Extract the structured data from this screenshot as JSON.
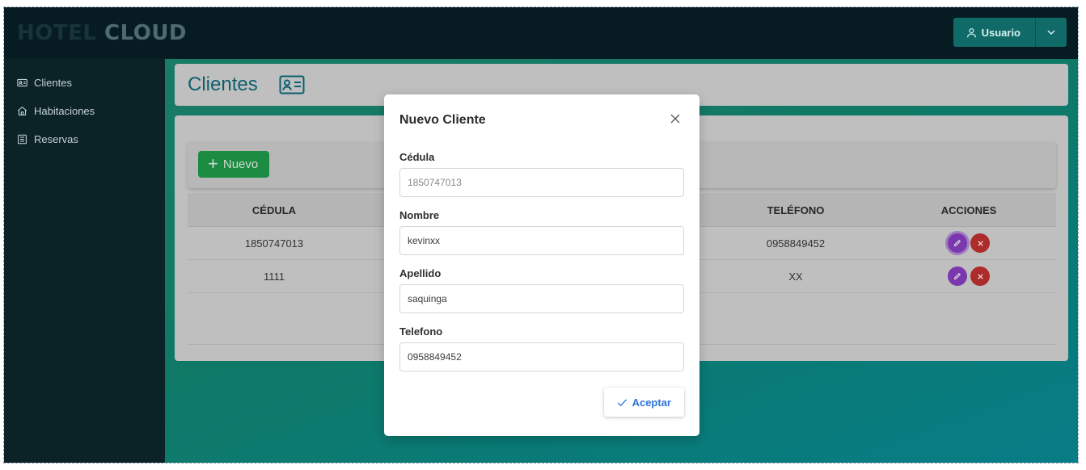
{
  "app": {
    "brand_part1": "HOTEL",
    "brand_part2": "CLOUD",
    "user_label": "Usuario"
  },
  "sidebar": {
    "items": [
      {
        "label": "Clientes",
        "icon": "id-card-icon"
      },
      {
        "label": "Habitaciones",
        "icon": "home-icon"
      },
      {
        "label": "Reservas",
        "icon": "list-icon"
      }
    ]
  },
  "page": {
    "title": "Clientes",
    "title_icon": "id-card-icon",
    "new_button_label": "Nuevo"
  },
  "table": {
    "headers": [
      "CÉDULA",
      "TELÉFONO",
      "ACCIONES"
    ],
    "rows": [
      {
        "cedula": "1850747013",
        "telefono": "0958849452"
      },
      {
        "cedula": "1111",
        "telefono": "XX"
      }
    ]
  },
  "modal": {
    "title": "Nuevo Cliente",
    "fields": [
      {
        "label": "Cédula",
        "value": "1850747013"
      },
      {
        "label": "Nombre",
        "value": "kevinxx"
      },
      {
        "label": "Apellido",
        "value": "saquinga"
      },
      {
        "label": "Telefono",
        "value": "0958849452"
      }
    ],
    "accept_label": "Aceptar"
  },
  "colors": {
    "topbar": "#061c22",
    "sidebar": "#0b2227",
    "accent_teal": "#0f6a68",
    "success_green": "#1fa04a",
    "edit_purple": "#8c3fc6",
    "delete_red": "#c73131",
    "link_blue": "#2b73d6"
  }
}
